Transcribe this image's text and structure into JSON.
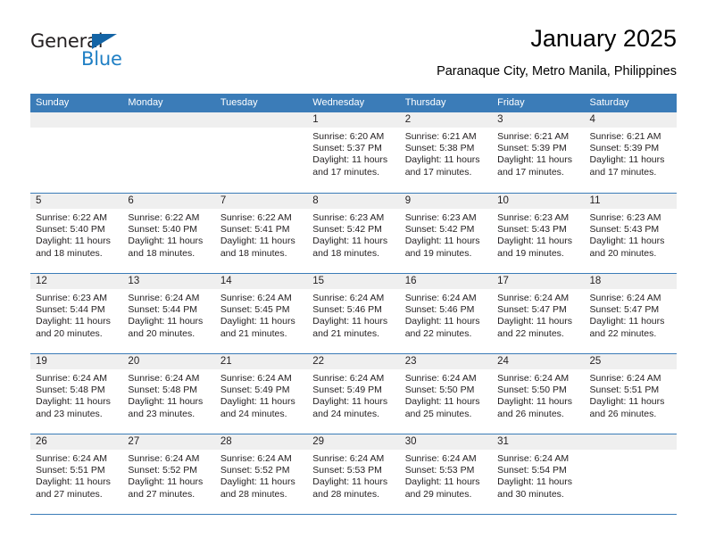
{
  "brand": {
    "name_part1": "General",
    "name_part2": "Blue",
    "triangle_icon": "triangle-icon",
    "accent_blue": "#1f7fc4",
    "logo_dark": "#231f20"
  },
  "header": {
    "title": "January 2025",
    "subtitle": "Paranaque City, Metro Manila, Philippines"
  },
  "calendar": {
    "header_bg": "#3b7cb8",
    "band_bg": "#efefef",
    "weekdays": [
      "Sunday",
      "Monday",
      "Tuesday",
      "Wednesday",
      "Thursday",
      "Friday",
      "Saturday"
    ],
    "weeks": [
      [
        {
          "day": "",
          "lines": []
        },
        {
          "day": "",
          "lines": []
        },
        {
          "day": "",
          "lines": []
        },
        {
          "day": "1",
          "lines": [
            "Sunrise: 6:20 AM",
            "Sunset: 5:37 PM",
            "Daylight: 11 hours",
            "and 17 minutes."
          ]
        },
        {
          "day": "2",
          "lines": [
            "Sunrise: 6:21 AM",
            "Sunset: 5:38 PM",
            "Daylight: 11 hours",
            "and 17 minutes."
          ]
        },
        {
          "day": "3",
          "lines": [
            "Sunrise: 6:21 AM",
            "Sunset: 5:39 PM",
            "Daylight: 11 hours",
            "and 17 minutes."
          ]
        },
        {
          "day": "4",
          "lines": [
            "Sunrise: 6:21 AM",
            "Sunset: 5:39 PM",
            "Daylight: 11 hours",
            "and 17 minutes."
          ]
        }
      ],
      [
        {
          "day": "5",
          "lines": [
            "Sunrise: 6:22 AM",
            "Sunset: 5:40 PM",
            "Daylight: 11 hours",
            "and 18 minutes."
          ]
        },
        {
          "day": "6",
          "lines": [
            "Sunrise: 6:22 AM",
            "Sunset: 5:40 PM",
            "Daylight: 11 hours",
            "and 18 minutes."
          ]
        },
        {
          "day": "7",
          "lines": [
            "Sunrise: 6:22 AM",
            "Sunset: 5:41 PM",
            "Daylight: 11 hours",
            "and 18 minutes."
          ]
        },
        {
          "day": "8",
          "lines": [
            "Sunrise: 6:23 AM",
            "Sunset: 5:42 PM",
            "Daylight: 11 hours",
            "and 18 minutes."
          ]
        },
        {
          "day": "9",
          "lines": [
            "Sunrise: 6:23 AM",
            "Sunset: 5:42 PM",
            "Daylight: 11 hours",
            "and 19 minutes."
          ]
        },
        {
          "day": "10",
          "lines": [
            "Sunrise: 6:23 AM",
            "Sunset: 5:43 PM",
            "Daylight: 11 hours",
            "and 19 minutes."
          ]
        },
        {
          "day": "11",
          "lines": [
            "Sunrise: 6:23 AM",
            "Sunset: 5:43 PM",
            "Daylight: 11 hours",
            "and 20 minutes."
          ]
        }
      ],
      [
        {
          "day": "12",
          "lines": [
            "Sunrise: 6:23 AM",
            "Sunset: 5:44 PM",
            "Daylight: 11 hours",
            "and 20 minutes."
          ]
        },
        {
          "day": "13",
          "lines": [
            "Sunrise: 6:24 AM",
            "Sunset: 5:44 PM",
            "Daylight: 11 hours",
            "and 20 minutes."
          ]
        },
        {
          "day": "14",
          "lines": [
            "Sunrise: 6:24 AM",
            "Sunset: 5:45 PM",
            "Daylight: 11 hours",
            "and 21 minutes."
          ]
        },
        {
          "day": "15",
          "lines": [
            "Sunrise: 6:24 AM",
            "Sunset: 5:46 PM",
            "Daylight: 11 hours",
            "and 21 minutes."
          ]
        },
        {
          "day": "16",
          "lines": [
            "Sunrise: 6:24 AM",
            "Sunset: 5:46 PM",
            "Daylight: 11 hours",
            "and 22 minutes."
          ]
        },
        {
          "day": "17",
          "lines": [
            "Sunrise: 6:24 AM",
            "Sunset: 5:47 PM",
            "Daylight: 11 hours",
            "and 22 minutes."
          ]
        },
        {
          "day": "18",
          "lines": [
            "Sunrise: 6:24 AM",
            "Sunset: 5:47 PM",
            "Daylight: 11 hours",
            "and 22 minutes."
          ]
        }
      ],
      [
        {
          "day": "19",
          "lines": [
            "Sunrise: 6:24 AM",
            "Sunset: 5:48 PM",
            "Daylight: 11 hours",
            "and 23 minutes."
          ]
        },
        {
          "day": "20",
          "lines": [
            "Sunrise: 6:24 AM",
            "Sunset: 5:48 PM",
            "Daylight: 11 hours",
            "and 23 minutes."
          ]
        },
        {
          "day": "21",
          "lines": [
            "Sunrise: 6:24 AM",
            "Sunset: 5:49 PM",
            "Daylight: 11 hours",
            "and 24 minutes."
          ]
        },
        {
          "day": "22",
          "lines": [
            "Sunrise: 6:24 AM",
            "Sunset: 5:49 PM",
            "Daylight: 11 hours",
            "and 24 minutes."
          ]
        },
        {
          "day": "23",
          "lines": [
            "Sunrise: 6:24 AM",
            "Sunset: 5:50 PM",
            "Daylight: 11 hours",
            "and 25 minutes."
          ]
        },
        {
          "day": "24",
          "lines": [
            "Sunrise: 6:24 AM",
            "Sunset: 5:50 PM",
            "Daylight: 11 hours",
            "and 26 minutes."
          ]
        },
        {
          "day": "25",
          "lines": [
            "Sunrise: 6:24 AM",
            "Sunset: 5:51 PM",
            "Daylight: 11 hours",
            "and 26 minutes."
          ]
        }
      ],
      [
        {
          "day": "26",
          "lines": [
            "Sunrise: 6:24 AM",
            "Sunset: 5:51 PM",
            "Daylight: 11 hours",
            "and 27 minutes."
          ]
        },
        {
          "day": "27",
          "lines": [
            "Sunrise: 6:24 AM",
            "Sunset: 5:52 PM",
            "Daylight: 11 hours",
            "and 27 minutes."
          ]
        },
        {
          "day": "28",
          "lines": [
            "Sunrise: 6:24 AM",
            "Sunset: 5:52 PM",
            "Daylight: 11 hours",
            "and 28 minutes."
          ]
        },
        {
          "day": "29",
          "lines": [
            "Sunrise: 6:24 AM",
            "Sunset: 5:53 PM",
            "Daylight: 11 hours",
            "and 28 minutes."
          ]
        },
        {
          "day": "30",
          "lines": [
            "Sunrise: 6:24 AM",
            "Sunset: 5:53 PM",
            "Daylight: 11 hours",
            "and 29 minutes."
          ]
        },
        {
          "day": "31",
          "lines": [
            "Sunrise: 6:24 AM",
            "Sunset: 5:54 PM",
            "Daylight: 11 hours",
            "and 30 minutes."
          ]
        },
        {
          "day": "",
          "lines": []
        }
      ]
    ]
  }
}
